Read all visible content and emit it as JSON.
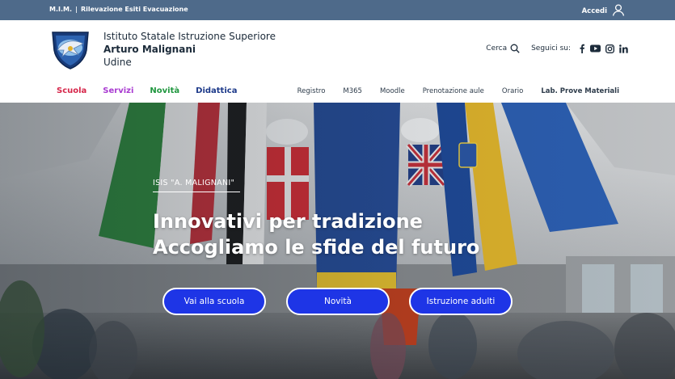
{
  "topbar": {
    "mim": "M.I.M.",
    "separator": "|",
    "evacuation": "Rilevazione Esiti Evacuazione",
    "login": "Accedi"
  },
  "header": {
    "school_line1": "Istituto Statale Istruzione Superiore",
    "school_line2": "Arturo Malignani",
    "school_line3": "Udine",
    "search_label": "Cerca",
    "follow_label": "Seguici su:",
    "social_icons": [
      "facebook-icon",
      "youtube-icon",
      "instagram-icon",
      "linkedin-icon"
    ]
  },
  "nav_main": [
    {
      "label": "Scuola",
      "color": "#d6264a"
    },
    {
      "label": "Servizi",
      "color": "#a93bd1"
    },
    {
      "label": "Novità",
      "color": "#20973f"
    },
    {
      "label": "Didattica",
      "color": "#1d3a8a"
    }
  ],
  "nav_side": [
    {
      "label": "Registro"
    },
    {
      "label": "M365"
    },
    {
      "label": "Moodle"
    },
    {
      "label": "Prenotazione aule"
    },
    {
      "label": "Orario"
    },
    {
      "label": "Lab. Prove Materiali"
    }
  ],
  "hero": {
    "kicker": "ISIS \"A. MALIGNANI\"",
    "headline_line1": "Innovativi per tradizione",
    "headline_line2": "Accogliamo le sfide del futuro",
    "buttons": [
      {
        "label": "Vai alla scuola"
      },
      {
        "label": "Novità"
      },
      {
        "label": "Istruzione adulti"
      }
    ],
    "button_color": "#1e35e6"
  },
  "colors": {
    "topbar": "#4e6a8a",
    "text_dark": "#1c2b3a"
  }
}
